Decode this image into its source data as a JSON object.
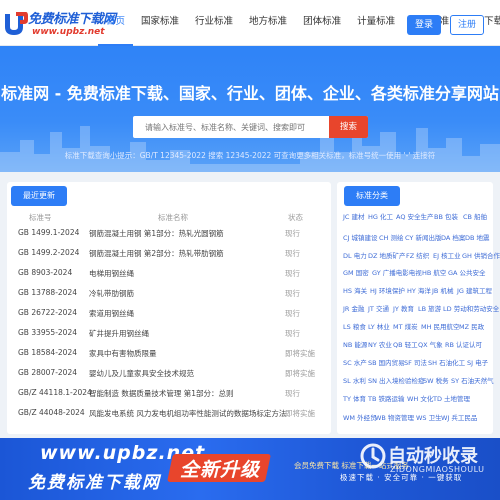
{
  "header": {
    "logo_title": "免费标准下载网",
    "logo_url": "www.upbz.net",
    "nav": [
      "首页",
      "国家标准",
      "行业标准",
      "地方标准",
      "团体标准",
      "计量标准",
      "企业标准",
      "图集下载"
    ],
    "login_label": "登录",
    "register_label": "注册"
  },
  "hero": {
    "title": "标准网 - 免费标准下载、国家、行业、团体、企业、各类标准分享网站",
    "search_placeholder": "请输入标准号、标准名称、关键词、搜索即可",
    "search_button": "搜索",
    "hint": "标准下载查询小提示：GB/T 12345-2022 搜索 12345-2022 可查询更多相关标准，标准号统一使用 '-' 连接符"
  },
  "latest": {
    "tab_label": "最近更新",
    "columns": [
      "标准号",
      "标准名称",
      "状态"
    ],
    "rows": [
      {
        "code": "GB 1499.1-2024",
        "name": "钢筋混凝土用钢 第1部分：热轧光圆钢筋",
        "status": "现行"
      },
      {
        "code": "GB 1499.2-2024",
        "name": "钢筋混凝土用钢 第2部分：热轧带肋钢筋",
        "status": "现行"
      },
      {
        "code": "GB 8903-2024",
        "name": "电梯用钢丝绳",
        "status": "现行"
      },
      {
        "code": "GB 13788-2024",
        "name": "冷轧带肋钢筋",
        "status": "现行"
      },
      {
        "code": "GB 26722-2024",
        "name": "索道用钢丝绳",
        "status": "现行"
      },
      {
        "code": "GB 33955-2024",
        "name": "矿井提升用钢丝绳",
        "status": "现行"
      },
      {
        "code": "GB 18584-2024",
        "name": "家具中有害物质限量",
        "status": "即将实施"
      },
      {
        "code": "GB 28007-2024",
        "name": "婴幼儿及儿童家具安全技术规范",
        "status": "即将实施"
      },
      {
        "code": "GB/Z 44118.1-2024",
        "name": "智能制造 数据质量技术管理 第1部分：总则",
        "status": "现行"
      },
      {
        "code": "GB/Z 44048-2024",
        "name": "风能发电系统 风力发电机组功率性能测试的数据场标定方法",
        "status": "即将实施"
      }
    ]
  },
  "categories": {
    "tab_label": "标准分类",
    "rows": [
      [
        "JC 建材",
        "HG 化工",
        "AQ 安全生产",
        "BB 包装",
        "CB 船舶"
      ],
      [
        "CJ 城镇建设",
        "CH 测绘",
        "CY 新闻出版",
        "DA 档案",
        "DB 地震"
      ],
      [
        "DL 电力",
        "DZ 地质矿产",
        "FZ 纺织",
        "EJ 核工业",
        "GH 供销合作"
      ],
      [
        "GM 国密",
        "GY 广播电影电视",
        "HB 航空",
        "GA 公共安全"
      ],
      [
        "HS 海关",
        "HJ 环境保护",
        "HY 海洋",
        "JB 机械",
        "JG 建筑工程"
      ],
      [
        "JR 金融",
        "JT 交通",
        "JY 教育",
        "LB 旅游",
        "LD 劳动和劳动安全"
      ],
      [
        "LS 粮食",
        "LY 林业",
        "MT 煤炭",
        "MH 民用航空",
        "MZ 民政"
      ],
      [
        "NB 能源",
        "NY 农业",
        "QB 轻工",
        "QX 气象",
        "RB 认证认可"
      ],
      [
        "SC 水产",
        "SB 国内贸易",
        "SF 司法",
        "SH 石油化工",
        "SJ 电子"
      ],
      [
        "SL 水利",
        "SN 出入境检验检疫",
        "SW 税务",
        "SY 石油天然气"
      ],
      [
        "TY 体育",
        "TB 铁路运输",
        "WH 文化",
        "TD 土地管理"
      ],
      [
        "WM 外经贸",
        "WB 物资管理",
        "WS 卫生",
        "WJ 兵工民品"
      ]
    ]
  },
  "banner": {
    "url": "www.upbz.net",
    "slogan": "免费标准下载网",
    "badge": "全新升级",
    "member_text": "会员免费下载 标准下载一站式服务",
    "actions": "极速下载 · 安全可靠 · 一键获取"
  },
  "watermark": {
    "text": "自动秒收录",
    "sub": "ZIDONGMIAOSHOULU"
  },
  "colors": {
    "primary": "#2d7df6",
    "search_button": "#e8452c",
    "category_link": "#3d6bd6"
  }
}
